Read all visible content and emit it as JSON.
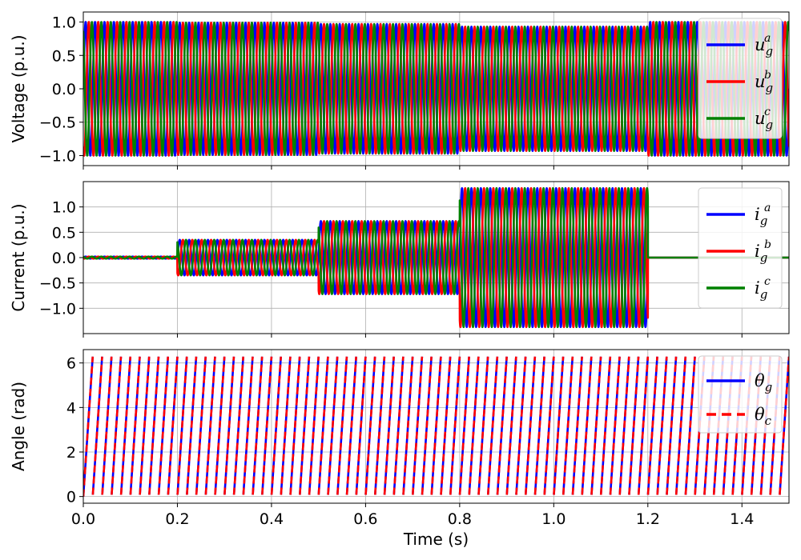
{
  "chart_data": [
    {
      "type": "line",
      "ylabel": "Voltage (p.u.)",
      "xlim": [
        0,
        1.5
      ],
      "ylim": [
        -1.15,
        1.15
      ],
      "yticks": [
        -1.0,
        -0.5,
        0.0,
        0.5,
        1.0
      ],
      "ytick_labels": [
        "−1.0",
        "−0.5",
        "0.0",
        "0.5",
        "1.0"
      ],
      "grid": true,
      "legend_position": "top-right",
      "frequency_hz": 50,
      "amplitude_segments": [
        {
          "t0": 0.0,
          "t1": 0.2,
          "amplitude": 1.0
        },
        {
          "t0": 0.2,
          "t1": 0.5,
          "amplitude": 0.99
        },
        {
          "t0": 0.5,
          "t1": 0.8,
          "amplitude": 0.97
        },
        {
          "t0": 0.8,
          "t1": 1.2,
          "amplitude": 0.93
        },
        {
          "t0": 1.2,
          "t1": 1.5,
          "amplitude": 1.0
        }
      ],
      "series": [
        {
          "name": "u_g^a",
          "legend_base": "u",
          "legend_sub": "g",
          "legend_sup": "a",
          "color": "#0000ff",
          "phase_deg": 0
        },
        {
          "name": "u_g^b",
          "legend_base": "u",
          "legend_sub": "g",
          "legend_sup": "b",
          "color": "#ff0000",
          "phase_deg": -120
        },
        {
          "name": "u_g^c",
          "legend_base": "u",
          "legend_sub": "g",
          "legend_sup": "c",
          "color": "#008000",
          "phase_deg": 120
        }
      ]
    },
    {
      "type": "line",
      "ylabel": "Current (p.u.)",
      "xlim": [
        0,
        1.5
      ],
      "ylim": [
        -1.5,
        1.5
      ],
      "yticks": [
        -1.0,
        -0.5,
        0.0,
        0.5,
        1.0
      ],
      "ytick_labels": [
        "−1.0",
        "−0.5",
        "0.0",
        "0.5",
        "1.0"
      ],
      "grid": true,
      "legend_position": "top-right",
      "frequency_hz": 50,
      "amplitude_segments": [
        {
          "t0": 0.0,
          "t1": 0.2,
          "amplitude": 0.02
        },
        {
          "t0": 0.2,
          "t1": 0.5,
          "amplitude": 0.35
        },
        {
          "t0": 0.5,
          "t1": 0.8,
          "amplitude": 0.72
        },
        {
          "t0": 0.8,
          "t1": 1.2,
          "amplitude": 1.37
        },
        {
          "t0": 1.2,
          "t1": 1.5,
          "amplitude": 0.0
        }
      ],
      "series": [
        {
          "name": "i_g^a",
          "legend_base": "i",
          "legend_sub": "g",
          "legend_sup": "a",
          "color": "#0000ff",
          "phase_deg": 0
        },
        {
          "name": "i_g^b",
          "legend_base": "i",
          "legend_sub": "g",
          "legend_sup": "b",
          "color": "#ff0000",
          "phase_deg": -120
        },
        {
          "name": "i_g^c",
          "legend_base": "i",
          "legend_sub": "g",
          "legend_sup": "c",
          "color": "#008000",
          "phase_deg": 120
        }
      ]
    },
    {
      "type": "line",
      "ylabel": "Angle (rad)",
      "xlabel": "Time (s)",
      "xlim": [
        0,
        1.5
      ],
      "ylim": [
        -0.3,
        6.6
      ],
      "yticks": [
        0,
        2,
        4,
        6
      ],
      "ytick_labels": [
        "0",
        "2",
        "4",
        "6"
      ],
      "xticks": [
        0.0,
        0.2,
        0.4,
        0.6,
        0.8,
        1.0,
        1.2,
        1.4
      ],
      "xtick_labels": [
        "0.0",
        "0.2",
        "0.4",
        "0.6",
        "0.8",
        "1.0",
        "1.2",
        "1.4"
      ],
      "grid": true,
      "legend_position": "top-right",
      "frequency_hz": 50,
      "wrap_max": 6.2832,
      "series": [
        {
          "name": "θ_g",
          "legend_base": "θ",
          "legend_sub": "g",
          "legend_sup": "",
          "color": "#0000ff",
          "dash": false,
          "phase_deg": 0
        },
        {
          "name": "θ_c",
          "legend_base": "θ",
          "legend_sub": "c",
          "legend_sup": "",
          "color": "#ff0000",
          "dash": true,
          "phase_deg": 0
        }
      ]
    }
  ]
}
